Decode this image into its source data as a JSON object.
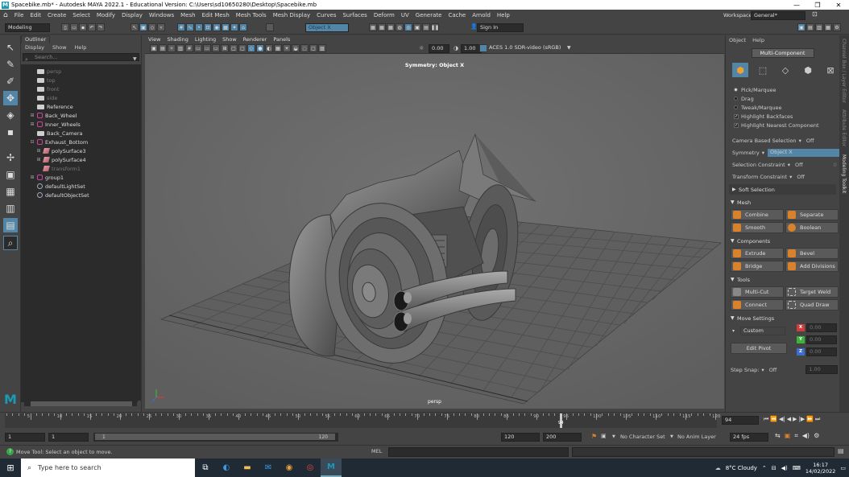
{
  "window": {
    "title": "Spacebike.mb* - Autodesk MAYA 2022.1 - Educational Version: C:\\Users\\sd10650280\\Desktop\\Spacebike.mb",
    "controls": [
      "—",
      "❐",
      "✕"
    ]
  },
  "menu": [
    "File",
    "Edit",
    "Create",
    "Select",
    "Modify",
    "Display",
    "Windows",
    "Mesh",
    "Edit Mesh",
    "Mesh Tools",
    "Mesh Display",
    "Curves",
    "Surfaces",
    "Deform",
    "UV",
    "Generate",
    "Cache",
    "Arnold",
    "Help"
  ],
  "workspace": {
    "label": "Workspace:",
    "value": "General*"
  },
  "statusline": {
    "mode": "Modeling",
    "object_field": "Object X",
    "sign_in": "Sign In"
  },
  "outliner": {
    "title": "Outliner",
    "menus": [
      "Display",
      "Show",
      "Help"
    ],
    "search_placeholder": "Search...",
    "items": [
      {
        "label": "persp",
        "icon": "camera-icon",
        "dim": true,
        "exp": ""
      },
      {
        "label": "top",
        "icon": "camera-icon",
        "dim": true,
        "exp": ""
      },
      {
        "label": "front",
        "icon": "camera-icon",
        "dim": true,
        "exp": ""
      },
      {
        "label": "side",
        "icon": "camera-icon",
        "dim": true,
        "exp": ""
      },
      {
        "label": "Reference",
        "icon": "camera-icon",
        "dim": false,
        "exp": ""
      },
      {
        "label": "Back_Wheel",
        "icon": "group-icon",
        "dim": false,
        "exp": "⊞"
      },
      {
        "label": "Inner_Wheels",
        "icon": "group-icon",
        "dim": false,
        "exp": "⊞"
      },
      {
        "label": "Back_Camera",
        "icon": "camera-icon",
        "dim": false,
        "exp": ""
      },
      {
        "label": "Exhaust_Bottom",
        "icon": "group-icon",
        "dim": false,
        "exp": "⊟"
      },
      {
        "label": "polySurface3",
        "icon": "mesh-icon",
        "dim": false,
        "exp": "⊞",
        "indent": 1
      },
      {
        "label": "polySurface4",
        "icon": "mesh-icon",
        "dim": false,
        "exp": "⊞",
        "indent": 1
      },
      {
        "label": "transform1",
        "icon": "mesh-icon",
        "dim": true,
        "exp": "",
        "indent": 1
      },
      {
        "label": "group1",
        "icon": "group-icon",
        "dim": false,
        "exp": "⊞"
      },
      {
        "label": "defaultLightSet",
        "icon": "light-icon",
        "dim": false,
        "exp": ""
      },
      {
        "label": "defaultObjectSet",
        "icon": "light-icon",
        "dim": false,
        "exp": ""
      }
    ]
  },
  "viewport": {
    "menus": [
      "View",
      "Shading",
      "Lighting",
      "Show",
      "Renderer",
      "Panels"
    ],
    "exposure": "0.00",
    "gamma": "1.00",
    "colorspace": "ACES 1.0 SDR-video (sRGB)",
    "symmetry_label": "Symmetry: Object X",
    "camera_label": "persp"
  },
  "modeling_toolkit": {
    "menus": [
      "Object",
      "Help"
    ],
    "multi_component": "Multi-Component",
    "select_modes": [
      "Pick/Marquee",
      "Drag",
      "Tweak/Marquee"
    ],
    "checks": [
      "Highlight Backfaces",
      "Highlight Nearest Component"
    ],
    "camera_based_selection": {
      "label": "Camera Based Selection",
      "value": "Off"
    },
    "symmetry": {
      "label": "Symmetry",
      "value": "Object X"
    },
    "selection_constraint": {
      "label": "Selection Constraint",
      "value": "Off",
      "num": "0"
    },
    "transform_constraint": {
      "label": "Transform Constraint",
      "value": "Off"
    },
    "soft_selection": "Soft Selection",
    "sections": {
      "mesh": "Mesh",
      "components": "Components",
      "tools": "Tools",
      "move_settings": "Move Settings"
    },
    "mesh_buttons": [
      "Combine",
      "Separate",
      "Smooth",
      "Boolean"
    ],
    "component_buttons": [
      "Extrude",
      "Bevel",
      "Bridge",
      "Add Divisions"
    ],
    "tool_buttons": [
      "Multi-Cut",
      "Target Weld",
      "Connect",
      "Quad Draw"
    ],
    "move": {
      "axis_mode": "Custom",
      "edit_pivot": "Edit Pivot",
      "axes": [
        {
          "label": "X",
          "value": "0.00",
          "color": "#d23c3c"
        },
        {
          "label": "Y",
          "value": "0.00",
          "color": "#3cb43c"
        },
        {
          "label": "Z",
          "value": "0.00",
          "color": "#3c6ed2"
        }
      ],
      "step_snap": {
        "label": "Step Snap:",
        "value": "Off",
        "num": "1.00"
      }
    },
    "side_tabs": [
      "Channel Box / Layer Editor",
      "Attribute Editor",
      "Modeling Toolkit"
    ]
  },
  "timeline": {
    "ticks": [
      "5",
      "10",
      "15",
      "20",
      "25",
      "30",
      "35",
      "40",
      "45",
      "50",
      "55",
      "60",
      "65",
      "70",
      "75",
      "80",
      "85",
      "90",
      "95",
      "100",
      "105",
      "110",
      "115",
      "120"
    ],
    "current_frame": "94",
    "current_frame_field": "94"
  },
  "range": {
    "start": "1",
    "anim_start": "1",
    "range_start": "1",
    "range_end": "120",
    "end": "120",
    "anim_end": "200",
    "character_set": "No Character Set",
    "anim_layer": "No Anim Layer",
    "fps": "24 fps"
  },
  "command": {
    "help_text": "Move Tool: Select an object to move.",
    "lang": "MEL"
  },
  "taskbar": {
    "search": "Type here to search",
    "weather": "8°C  Cloudy",
    "time": "16:17",
    "date": "14/02/2022"
  }
}
